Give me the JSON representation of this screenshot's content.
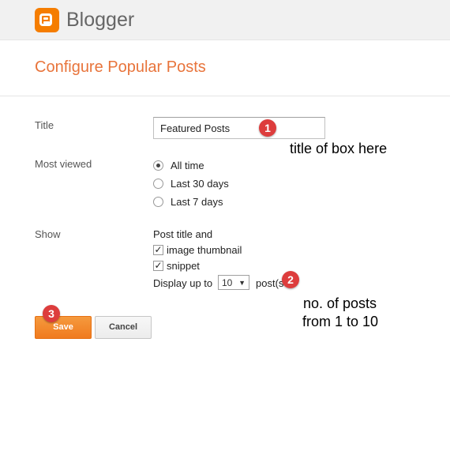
{
  "header": {
    "brand": "Blogger",
    "logo_icon": "blogger-logo-icon"
  },
  "page": {
    "title": "Configure Popular Posts"
  },
  "form": {
    "title_label": "Title",
    "title_value": "Featured Posts",
    "most_viewed_label": "Most viewed",
    "most_viewed_options": [
      "All time",
      "Last 30 days",
      "Last 7 days"
    ],
    "most_viewed_selected": "All time",
    "show_label": "Show",
    "show_intro": "Post title and",
    "image_thumbnail_label": "image thumbnail",
    "image_thumbnail_checked": true,
    "snippet_label": "snippet",
    "snippet_checked": true,
    "display_prefix": "Display up to",
    "display_count": "10",
    "display_suffix": "post(s"
  },
  "buttons": {
    "save": "Save",
    "cancel": "Cancel"
  },
  "annotations": {
    "badge1": "1",
    "badge2": "2",
    "badge3": "3",
    "note1": "title of box here",
    "note2_line1": "no. of posts",
    "note2_line2": "from 1 to 10"
  },
  "colors": {
    "accent": "#e8743b",
    "badge": "#dd3d3d",
    "save_button": "#f07a1e"
  }
}
